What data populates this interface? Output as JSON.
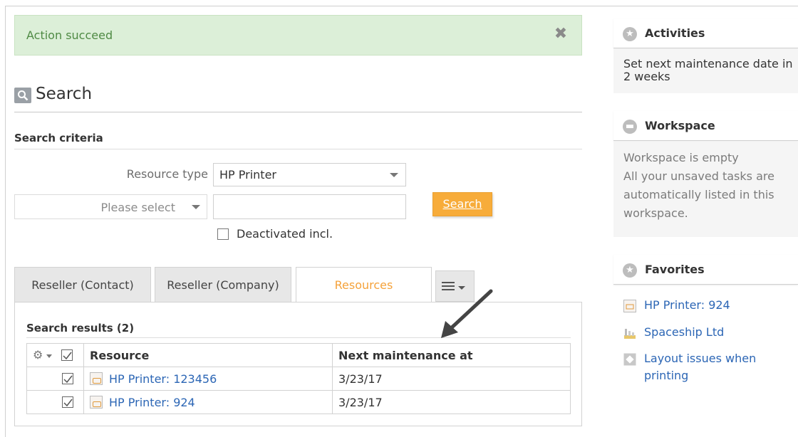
{
  "alert": {
    "message": "Action succeed",
    "close_symbol": "✖"
  },
  "search": {
    "title": "Search",
    "criteria_title": "Search criteria",
    "resource_type_label": "Resource type",
    "resource_type_value": "HP Printer",
    "field_select_placeholder": "Please select",
    "text_value": "",
    "search_button": "Search",
    "deactivated_label": "Deactivated incl."
  },
  "tabs": [
    {
      "label": "Reseller (Contact)",
      "active": false
    },
    {
      "label": "Reseller (Company)",
      "active": false
    },
    {
      "label": "Resources",
      "active": true
    }
  ],
  "results": {
    "title": "Search results (2)",
    "columns": [
      "Resource",
      "Next maintenance at"
    ],
    "rows": [
      {
        "resource": "HP Printer: 123456",
        "next_maintenance": "3/23/17",
        "checked": true
      },
      {
        "resource": "HP Printer: 924",
        "next_maintenance": "3/23/17",
        "checked": true
      }
    ]
  },
  "sidebar": {
    "activities": {
      "title": "Activities",
      "text": "Set next maintenance date in 2 weeks"
    },
    "workspace": {
      "title": "Workspace",
      "line1": "Workspace is empty",
      "line2": "All your unsaved tasks are automatically listed in this workspace."
    },
    "favorites": {
      "title": "Favorites",
      "items": [
        {
          "label": "HP Printer: 924",
          "icon": "printer-icon"
        },
        {
          "label": "Spaceship Ltd",
          "icon": "company-icon"
        },
        {
          "label": "Layout issues when printing",
          "icon": "ticket-icon"
        }
      ]
    }
  },
  "colors": {
    "accent": "#f7ac3a",
    "link": "#2c66b5",
    "alert_bg": "#dcefd8",
    "alert_text": "#4f8a44"
  }
}
